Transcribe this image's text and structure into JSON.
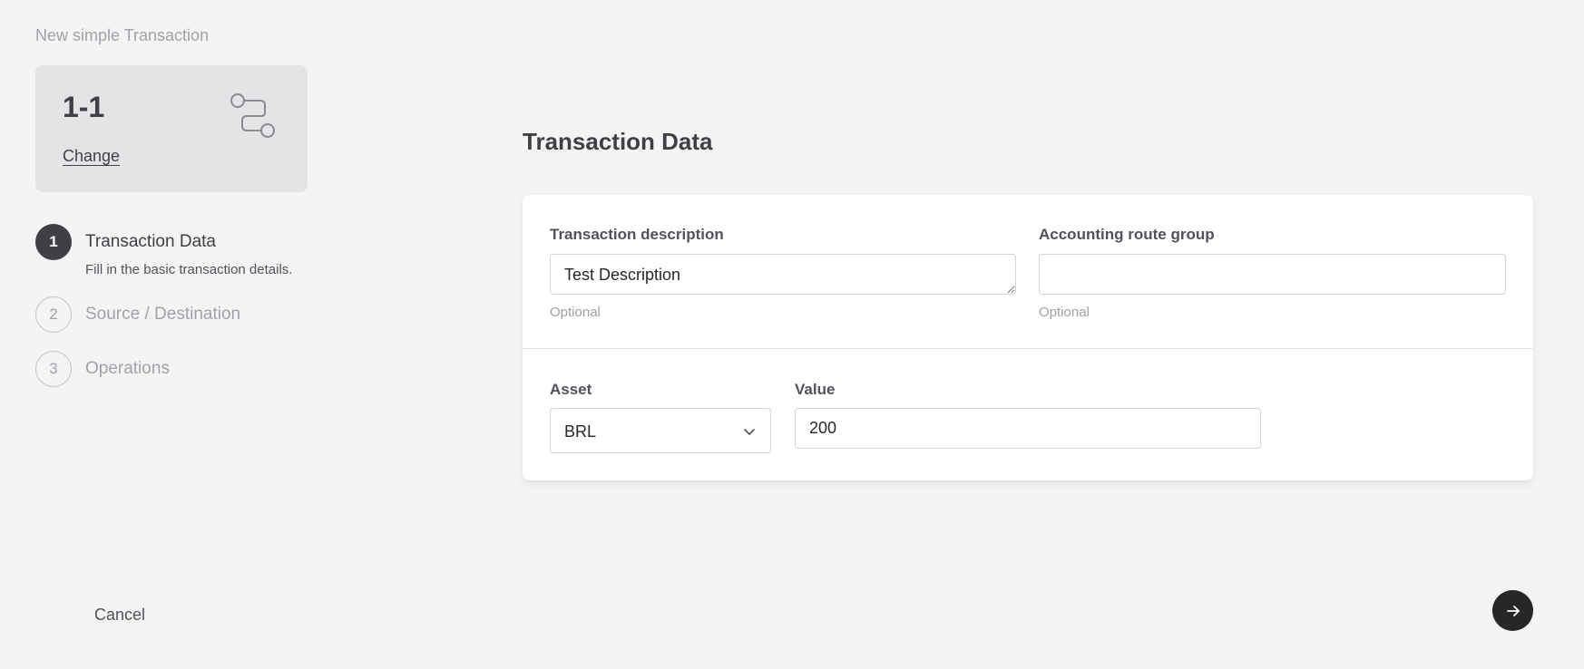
{
  "header": {
    "subtitle": "New simple Transaction"
  },
  "type_card": {
    "title": "1-1",
    "change_label": "Change",
    "icon": "route-icon"
  },
  "steps": [
    {
      "number": "1",
      "label": "Transaction Data",
      "description": "Fill in the basic transaction details.",
      "state": "active"
    },
    {
      "number": "2",
      "label": "Source / Destination",
      "state": "inactive"
    },
    {
      "number": "3",
      "label": "Operations",
      "state": "inactive"
    }
  ],
  "main": {
    "title": "Transaction Data"
  },
  "form": {
    "description": {
      "label": "Transaction description",
      "value": "Test Description",
      "hint": "Optional"
    },
    "route_group": {
      "label": "Accounting route group",
      "value": "",
      "hint": "Optional"
    },
    "asset": {
      "label": "Asset",
      "selected": "BRL"
    },
    "amount": {
      "label": "Value",
      "value": "200"
    }
  },
  "footer": {
    "cancel_label": "Cancel",
    "next_icon": "arrow-right-icon"
  },
  "colors": {
    "background": "#f4f4f4",
    "card": "#ffffff",
    "active_step": "#3f3f46",
    "primary_button": "#27272a"
  }
}
